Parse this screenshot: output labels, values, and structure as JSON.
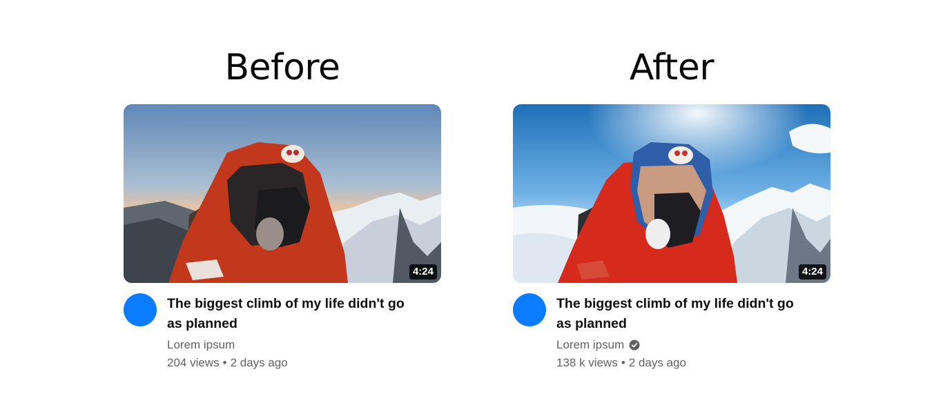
{
  "before": {
    "heading": "Before",
    "duration": "4:24",
    "title": "The biggest climb of my life didn't go as planned",
    "channel": "Lorem ipsum",
    "views": "204 views",
    "separator": "•",
    "age": "2 days ago",
    "verified": false
  },
  "after": {
    "heading": "After",
    "duration": "4:24",
    "title": "The biggest climb of my life didn't go as planned",
    "channel": "Lorem ipsum",
    "views": "138 k views",
    "separator": "•",
    "age": "2 days ago",
    "verified": true,
    "verified_icon": "verified-check-icon"
  },
  "colors": {
    "avatar": "#0a7cff",
    "text_primary": "#0f0f0f",
    "text_secondary": "#606060",
    "duration_bg": "#000000"
  }
}
